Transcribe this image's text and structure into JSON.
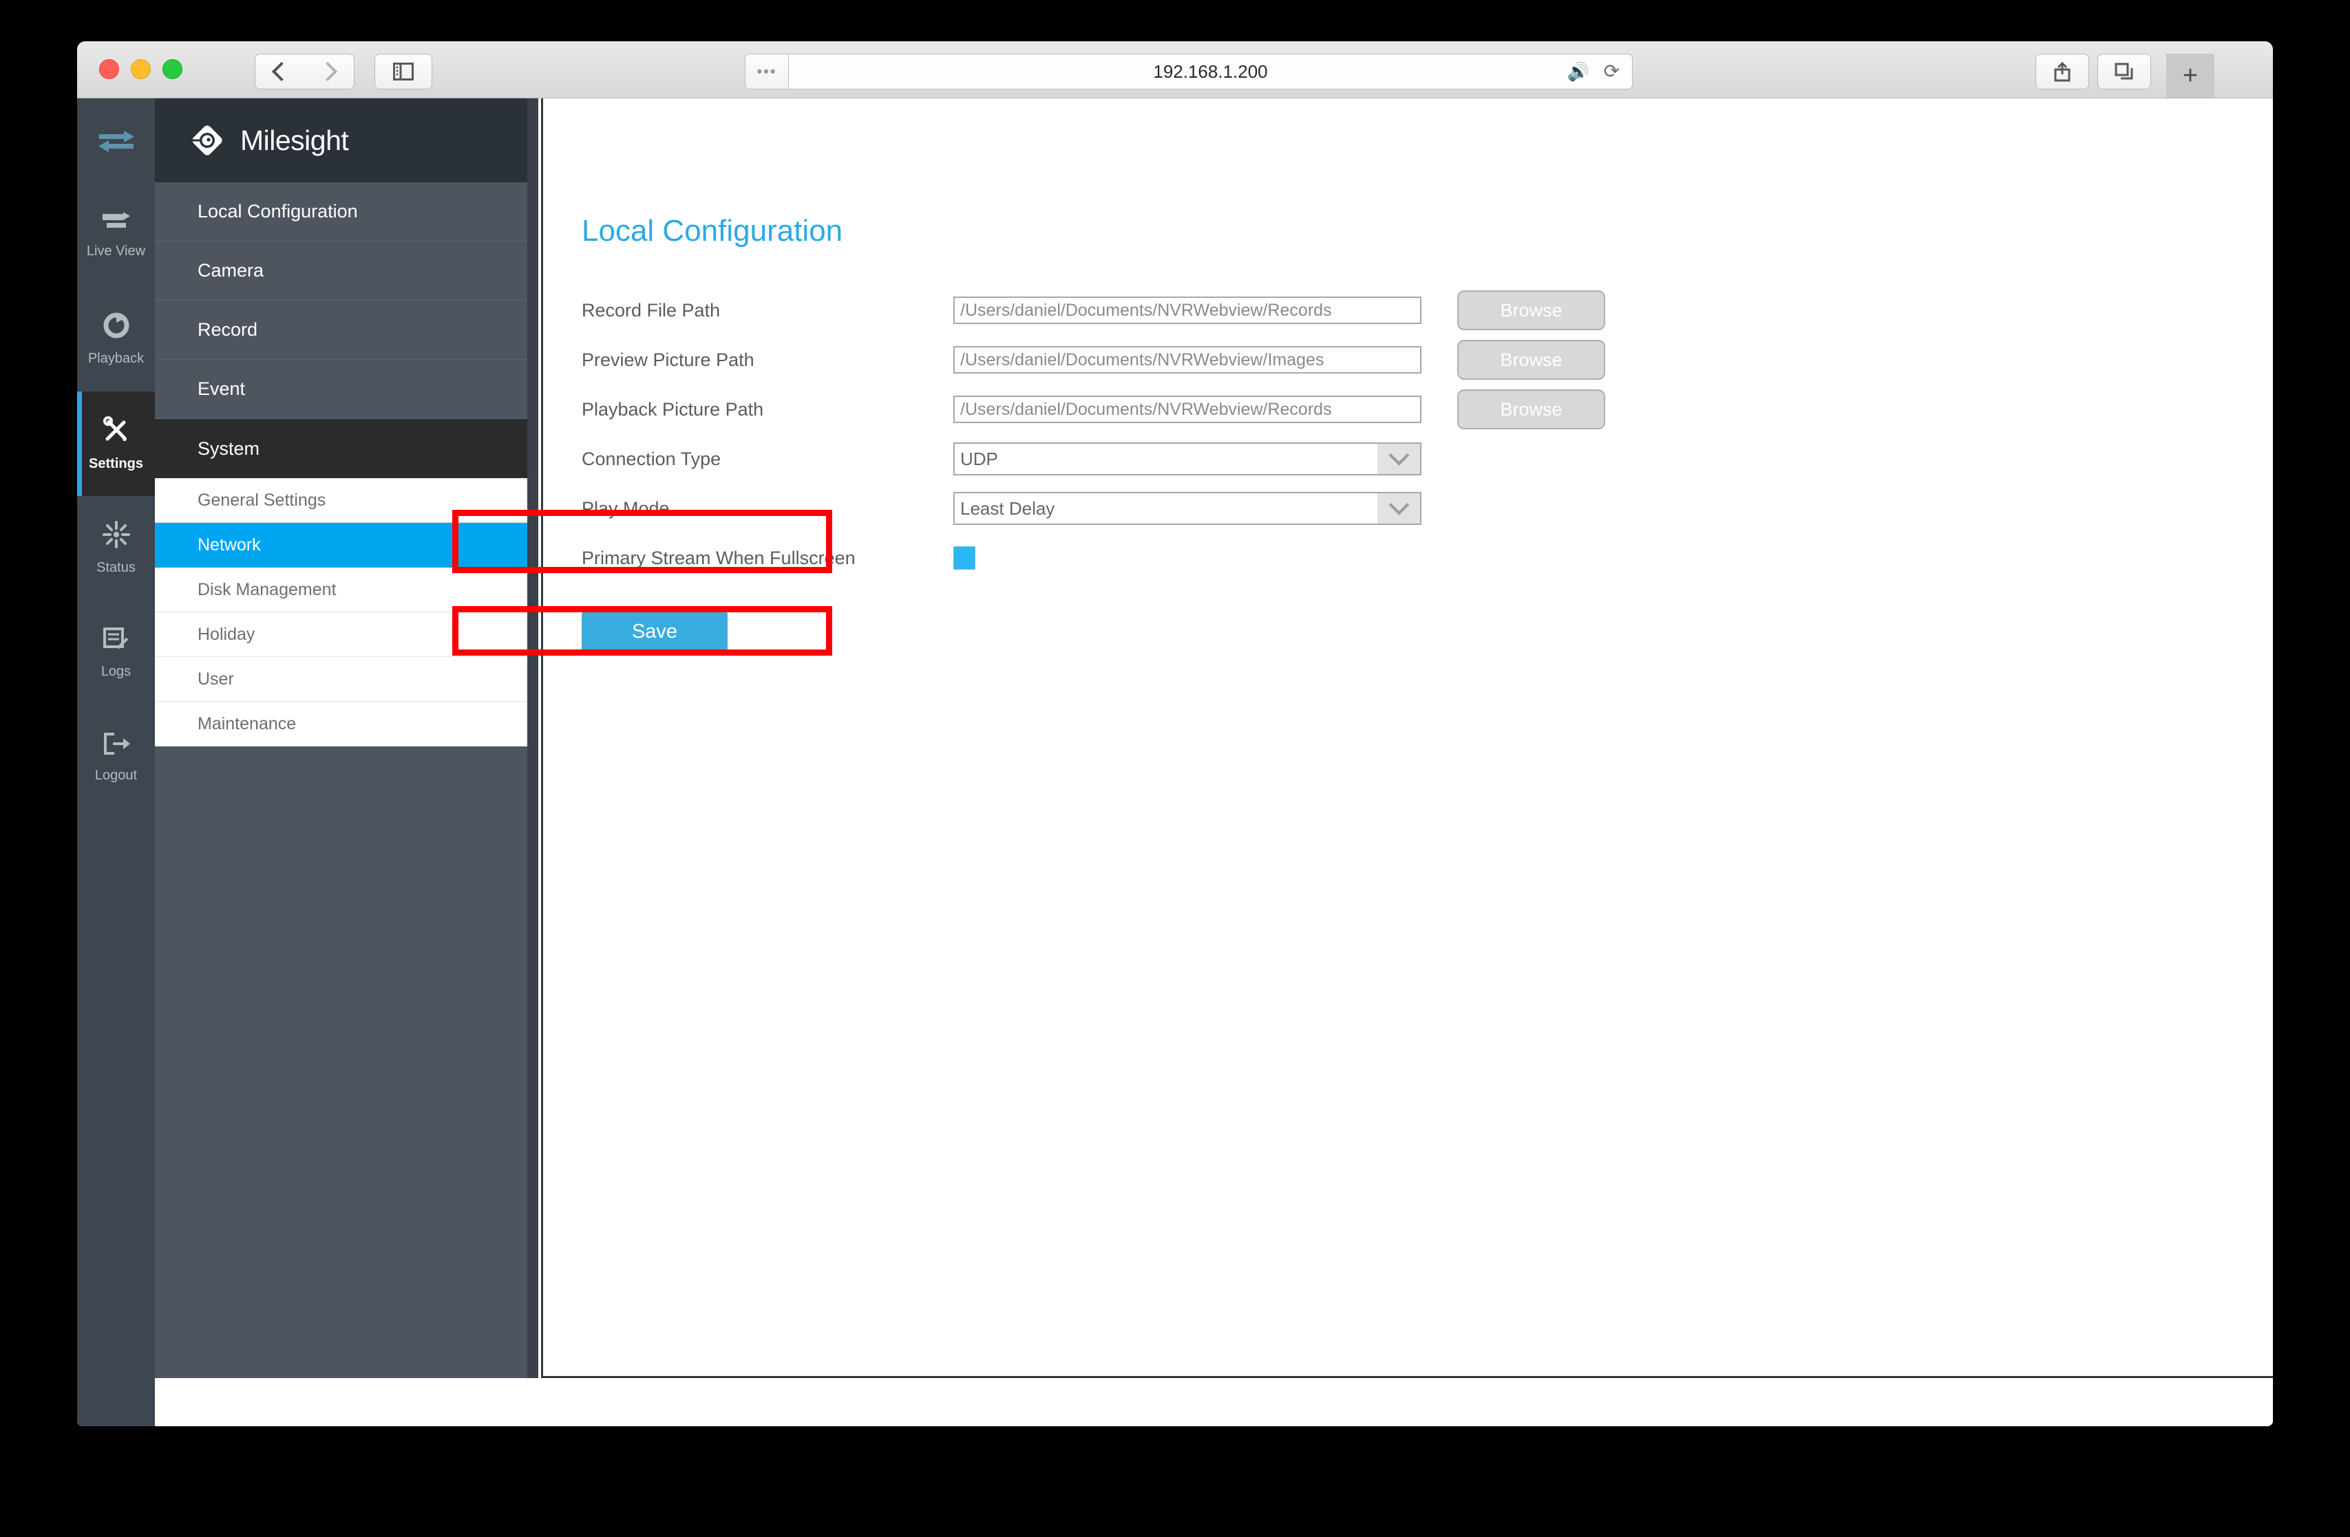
{
  "browser": {
    "url": "192.168.1.200",
    "reader_label": "•••",
    "speaker_icon": "speaker-icon",
    "reload_icon": "reload-icon",
    "back_icon": "chevron-left-icon",
    "forward_icon": "chevron-right-icon",
    "sidebar_toggle_icon": "sidebar-toggle-icon",
    "share_icon": "share-icon",
    "tabs_icon": "tabs-overview-icon",
    "newtab_label": "+"
  },
  "rail": {
    "top_icon": "transfer-arrows-icon",
    "items": [
      {
        "label": "Live View",
        "icon": "live-view-icon",
        "active": false
      },
      {
        "label": "Playback",
        "icon": "playback-icon",
        "active": false
      },
      {
        "label": "Settings",
        "icon": "settings-tools-icon",
        "active": true
      },
      {
        "label": "Status",
        "icon": "status-burst-icon",
        "active": false
      },
      {
        "label": "Logs",
        "icon": "logs-icon",
        "active": false
      },
      {
        "label": "Logout",
        "icon": "logout-icon",
        "active": false
      }
    ]
  },
  "sidebar": {
    "brand": "Milesight",
    "logo_icon": "milesight-diamond-logo",
    "nav": [
      {
        "label": "Local Configuration",
        "current": false
      },
      {
        "label": "Camera",
        "current": false
      },
      {
        "label": "Record",
        "current": false
      },
      {
        "label": "Event",
        "current": false
      },
      {
        "label": "System",
        "current": true
      }
    ],
    "submenu": [
      {
        "label": "General Settings",
        "selected": false
      },
      {
        "label": "Network",
        "selected": true
      },
      {
        "label": "Disk Management",
        "selected": false
      },
      {
        "label": "Holiday",
        "selected": false
      },
      {
        "label": "User",
        "selected": false
      },
      {
        "label": "Maintenance",
        "selected": false
      }
    ]
  },
  "main": {
    "title": "Local Configuration",
    "rows": [
      {
        "label": "Record File Path",
        "value": "/Users/daniel/Documents/NVRWebview/Records",
        "browse": "Browse"
      },
      {
        "label": "Preview Picture Path",
        "value": "/Users/daniel/Documents/NVRWebview/Images",
        "browse": "Browse"
      },
      {
        "label": "Playback Picture Path",
        "value": "/Users/daniel/Documents/NVRWebview/Records",
        "browse": "Browse"
      }
    ],
    "connection_type": {
      "label": "Connection Type",
      "value": "UDP"
    },
    "play_mode": {
      "label": "Play Mode",
      "value": "Least Delay"
    },
    "primary_stream": {
      "label": "Primary Stream When Fullscreen",
      "checked": true
    },
    "save_label": "Save"
  },
  "colors": {
    "accent_blue": "#00a5f0",
    "title_blue": "#2aaae2",
    "save_blue": "#3aade0",
    "highlight_red": "#ff0000",
    "rail_bg": "#3e4650",
    "sidebar_bg": "#4e555f"
  }
}
